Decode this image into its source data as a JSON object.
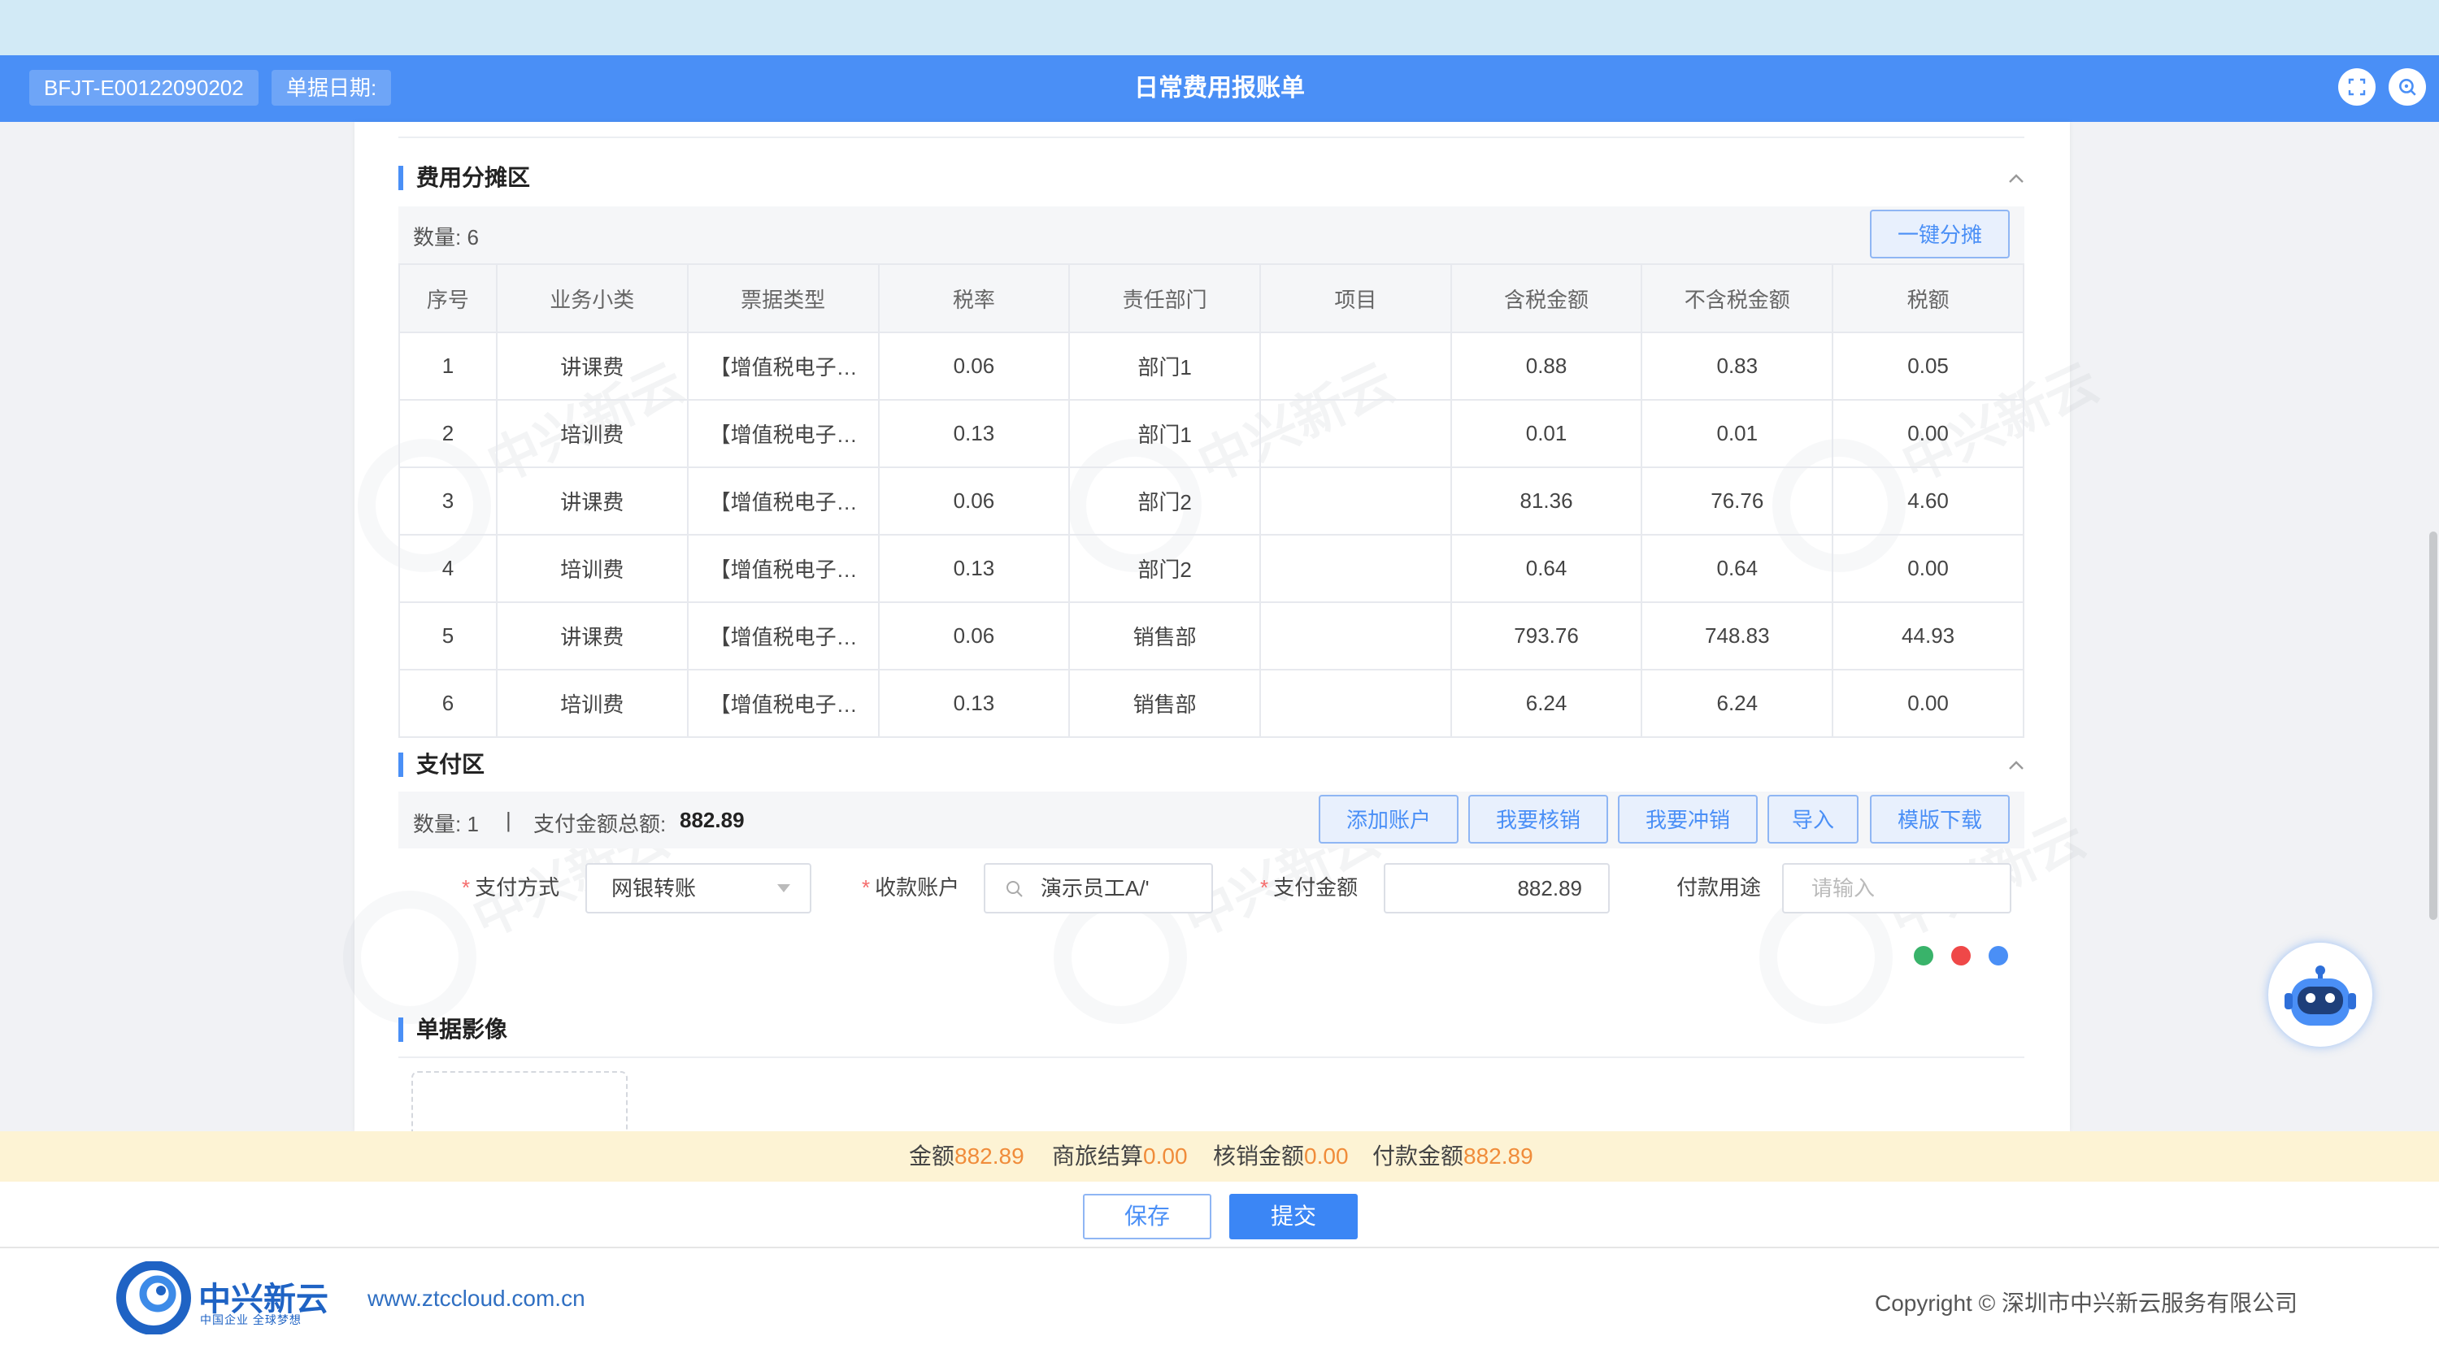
{
  "header": {
    "doc_no": "BFJT-E00122090202",
    "date_label": "单据日期:",
    "title": "日常费用报账单",
    "fullscreen_icon": "fullscreen-icon",
    "zoom_icon": "zoom-icon"
  },
  "allocation": {
    "title": "费用分摊区",
    "count_label": "数量: 6",
    "one_click_button": "一键分摊",
    "columns": [
      "序号",
      "业务小类",
      "票据类型",
      "税率",
      "责任部门",
      "项目",
      "含税金额",
      "不含税金额",
      "税额"
    ],
    "rows": [
      [
        "1",
        "讲课费",
        "【增值税电子…",
        "0.06",
        "部门1",
        "",
        "0.88",
        "0.83",
        "0.05"
      ],
      [
        "2",
        "培训费",
        "【增值税电子…",
        "0.13",
        "部门1",
        "",
        "0.01",
        "0.01",
        "0.00"
      ],
      [
        "3",
        "讲课费",
        "【增值税电子…",
        "0.06",
        "部门2",
        "",
        "81.36",
        "76.76",
        "4.60"
      ],
      [
        "4",
        "培训费",
        "【增值税电子…",
        "0.13",
        "部门2",
        "",
        "0.64",
        "0.64",
        "0.00"
      ],
      [
        "5",
        "讲课费",
        "【增值税电子…",
        "0.06",
        "销售部",
        "",
        "793.76",
        "748.83",
        "44.93"
      ],
      [
        "6",
        "培训费",
        "【增值税电子…",
        "0.13",
        "销售部",
        "",
        "6.24",
        "6.24",
        "0.00"
      ]
    ]
  },
  "payment": {
    "title": "支付区",
    "count_label": "数量: 1",
    "separator": "|",
    "total_label": "支付金额总额:",
    "total_value": "882.89",
    "buttons": {
      "add_account": "添加账户",
      "verify": "我要核销",
      "offset": "我要冲销",
      "import": "导入",
      "template": "模版下载"
    },
    "method_label": "支付方式",
    "method_value": "网银转账",
    "payee_label": "收款账户",
    "payee_value": "演示员工A/'",
    "amount_label": "支付金额",
    "amount_value": "882.89",
    "purpose_label": "付款用途",
    "purpose_placeholder": "请输入"
  },
  "image_section": {
    "title": "单据影像"
  },
  "summary": {
    "amount_label": "金额",
    "amount_value": "882.89",
    "travel_label": "商旅结算",
    "travel_value": "0.00",
    "verify_label": "核销金额",
    "verify_value": "0.00",
    "pay_label": "付款金额",
    "pay_value": "882.89"
  },
  "actions": {
    "save": "保存",
    "submit": "提交"
  },
  "footer": {
    "logo_name": "中兴新云",
    "logo_sub": "中国企业 全球梦想",
    "url": "www.ztccloud.com.cn",
    "copyright": "Copyright © 深圳市中兴新云服务有限公司"
  },
  "watermark": "中兴新云",
  "colors": {
    "primary": "#4a8ff6",
    "accent_orange": "#f08c3a",
    "required": "#f56c6c"
  }
}
